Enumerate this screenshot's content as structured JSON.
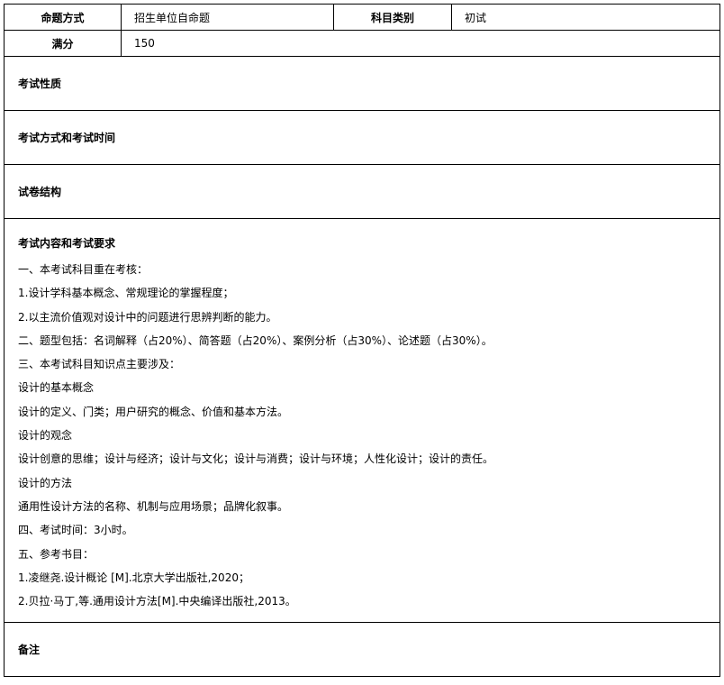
{
  "header": {
    "mode_label": "命题方式",
    "mode_value": "招生单位自命题",
    "category_label": "科目类别",
    "category_value": "初试",
    "score_label": "满分",
    "score_value": "150"
  },
  "sections": {
    "nature": "考试性质",
    "method_time": "考试方式和考试时间",
    "structure": "试卷结构",
    "content_title": "考试内容和考试要求",
    "content_lines": [
      "一、本考试科目重在考核：",
      "1.设计学科基本概念、常规理论的掌握程度；",
      "2.以主流价值观对设计中的问题进行思辨判断的能力。",
      "二、题型包括：名词解释（占20%）、简答题（占20%）、案例分析（占30%）、论述题（占30%）。",
      "三、本考试科目知识点主要涉及：",
      "设计的基本概念",
      "设计的定义、门类；用户研究的概念、价值和基本方法。",
      "设计的观念",
      "设计创意的思维；设计与经济；设计与文化；设计与消费；设计与环境；人性化设计；设计的责任。",
      "设计的方法",
      "通用性设计方法的名称、机制与应用场景；品牌化叙事。",
      "四、考试时间：3小时。",
      "五、参考书目：",
      "1.凌继尧.设计概论 [M].北京大学出版社,2020；",
      "2.贝拉·马丁,等.通用设计方法[M].中央编译出版社,2013。"
    ],
    "remarks": "备注"
  }
}
